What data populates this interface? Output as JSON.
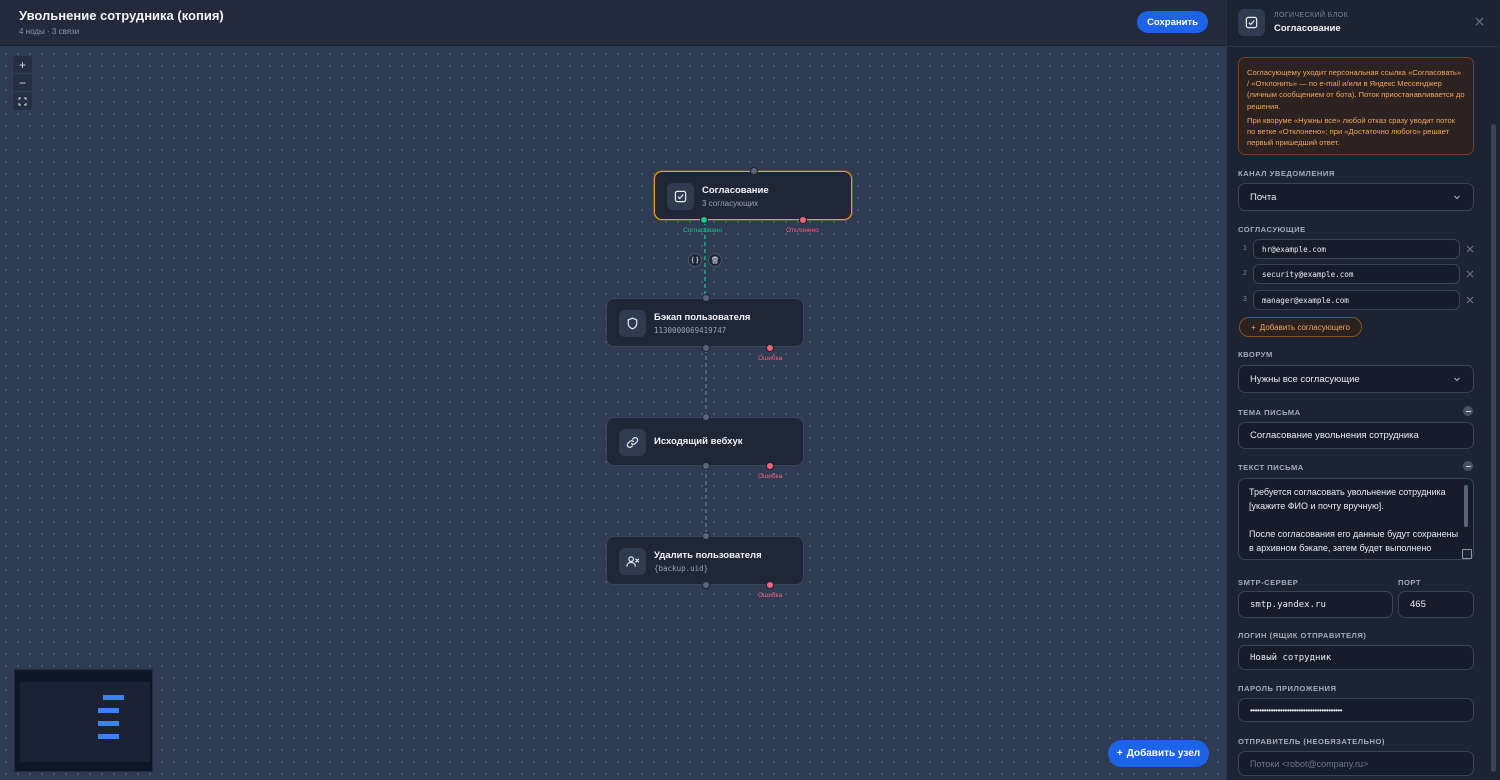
{
  "header": {
    "title": "Увольнение сотрудника (копия)",
    "subtitle": "4 ноды · 3 связи",
    "save_label": "Сохранить"
  },
  "zoom_controls": {
    "zoom_in": "+",
    "zoom_out": "−",
    "fit": "⛶"
  },
  "nodes": [
    {
      "title": "Согласование",
      "subtitle": "3 согласующих",
      "icon": "checkbox-icon",
      "selected": true,
      "ports": {
        "ok": "Согласовано",
        "err": "Отклонено"
      }
    },
    {
      "title": "Бэкап пользователя",
      "subtitle": "1130000069419747",
      "icon": "shield-icon",
      "ports": {
        "err": "Ошибка"
      }
    },
    {
      "title": "Исходящий вебхук",
      "subtitle": "",
      "icon": "link-icon",
      "ports": {
        "err": "Ошибка"
      }
    },
    {
      "title": "Удалить пользователя",
      "subtitle": "{backup.uid}",
      "icon": "user-remove-icon",
      "ports": {
        "err": "Ошибка"
      }
    }
  ],
  "add_node_label": "Добавить узел",
  "panel": {
    "kicker": "ЛОГИЧЕСКИЙ БЛОК",
    "title": "Согласование",
    "alert": [
      "Согласующему уходит персональная ссылка «Согласовать» / «Отклонить» — по e-mail и/или в Яндекс Мессенджер (личным сообщением от бота). Поток приостанавливается до решения.",
      "При кворуме «Нужны все» любой отказ сразу уводит поток по ветке «Отклонено»; при «Достаточно любого» решает первый пришедший ответ."
    ],
    "channel": {
      "label": "КАНАЛ УВЕДОМЛЕНИЯ",
      "value": "Почта"
    },
    "approvers": {
      "label": "СОГЛАСУЮЩИЕ",
      "items": [
        {
          "num": "1",
          "email": "hr@example.com"
        },
        {
          "num": "2",
          "email": "security@example.com"
        },
        {
          "num": "3",
          "email": "manager@example.com"
        }
      ],
      "add_label": "Добавить согласующего"
    },
    "quorum": {
      "label": "КВОРУМ",
      "value": "Нужны все согласующие"
    },
    "subject": {
      "label": "ТЕМА ПИСЬМА",
      "value": "Согласование увольнения сотрудника"
    },
    "body": {
      "label": "ТЕКСТ ПИСЬМА",
      "value": "Требуется согласовать увольнение сотрудника [укажите ФИО и почту вручную].\n\nПосле согласования его данные будут сохранены в архивном бэкапе, затем будет выполнено удаление"
    },
    "smtp": {
      "label": "SMTP-СЕРВЕР",
      "value": "smtp.yandex.ru"
    },
    "port": {
      "label": "ПОРТ",
      "value": "465"
    },
    "login": {
      "label": "ЛОГИН (ЯЩИК ОТПРАВИТЕЛЯ)",
      "value": "Новый сотрудник"
    },
    "password": {
      "label": "ПАРОЛЬ ПРИЛОЖЕНИЯ",
      "value": "••••••••••••••••••••••••••••••••••••••••"
    },
    "sender": {
      "label": "ОТПРАВИТЕЛЬ (НЕОБЯЗАТЕЛЬНО)",
      "placeholder": "Потоки <robot@company.ru>"
    }
  },
  "colors": {
    "accent": "#1d63e8",
    "selected_border": "#f0a020",
    "ok": "#22c28a",
    "error": "#f0637a",
    "warning_text": "#f2a65a"
  }
}
